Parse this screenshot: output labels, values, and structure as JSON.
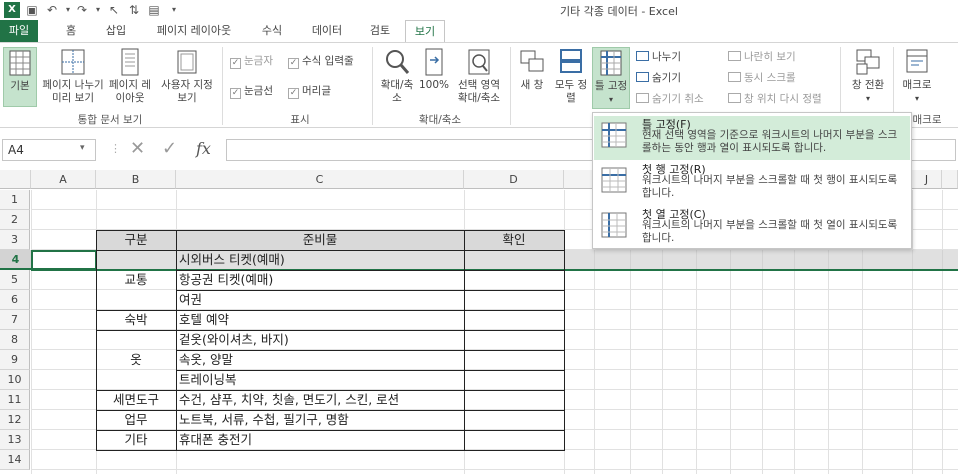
{
  "window": {
    "title": "기타 각종 데이터 - Excel"
  },
  "tabs": [
    "파일",
    "홈",
    "삽입",
    "페이지 레이아웃",
    "수식",
    "데이터",
    "검토",
    "보기"
  ],
  "ribbon": {
    "workbook_views": {
      "group": "통합 문서 보기",
      "normal": "기본",
      "page_break": "페이지 나누기 미리 보기",
      "page_layout": "페이지 레이아웃",
      "custom": "사용자 지정 보기"
    },
    "show": {
      "group": "표시",
      "ruler": "눈금자",
      "formula_bar": "수식 입력줄",
      "gridlines": "눈금선",
      "headings": "머리글"
    },
    "zoom": {
      "group": "확대/축소",
      "zoom": "확대/축소",
      "zoom100": "100%",
      "zoom_selection": "선택 영역 확대/축소"
    },
    "window": {
      "new_window": "새 창",
      "arrange_all": "모두 정렬",
      "freeze_panes": "틀 고정",
      "split": "나누기",
      "hide": "숨기기",
      "unhide": "숨기기 취소",
      "side_by_side": "나란히 보기",
      "sync_scroll": "동시 스크롤",
      "reset_pos": "창 위치 다시 정렬",
      "switch": "창 전환"
    },
    "macros": {
      "macro": "매크로",
      "group": "매크로"
    }
  },
  "formula_bar": {
    "name_box": "A4",
    "fx": "fx"
  },
  "columns": [
    "A",
    "B",
    "C",
    "D",
    "J"
  ],
  "rows": [
    "1",
    "2",
    "3",
    "4",
    "5",
    "6",
    "7",
    "8",
    "9",
    "10",
    "11",
    "12",
    "13",
    "14"
  ],
  "table": {
    "headers": [
      "구분",
      "준비물",
      "확인"
    ],
    "categories": [
      {
        "label": "교통"
      },
      {
        "label": "숙박"
      },
      {
        "label": "옷"
      },
      {
        "label": "세면도구"
      },
      {
        "label": "업무"
      },
      {
        "label": "기타"
      }
    ],
    "items": [
      "시외버스 티켓(예매)",
      "항공권 티켓(예매)",
      "여권",
      "호텔 예약",
      "겉옷(와이셔츠, 바지)",
      "속옷, 양말",
      "트레이닝복",
      "수건, 샴푸, 치약, 칫솔, 면도기, 스킨, 로션",
      "노트북, 서류, 수첩, 필기구, 명함",
      "휴대폰 충전기"
    ]
  },
  "freeze_menu": [
    {
      "title": "틀 고정(F)",
      "desc": "현재 선택 영역을 기준으로 워크시트의 나머지 부분을 스크롤하는 동안 행과 열이 표시되도록 합니다."
    },
    {
      "title": "첫 행 고정(R)",
      "desc": "워크시트의 나머지 부분을 스크롤할 때 첫 행이 표시되도록 합니다."
    },
    {
      "title": "첫 열 고정(C)",
      "desc": "워크시트의 나머지 부분을 스크롤할 때 첫 열이 표시되도록 합니다."
    }
  ],
  "colors": {
    "excel_green": "#217346",
    "highlight": "#d3ecd9",
    "selected_row": "#c6c6c6"
  }
}
